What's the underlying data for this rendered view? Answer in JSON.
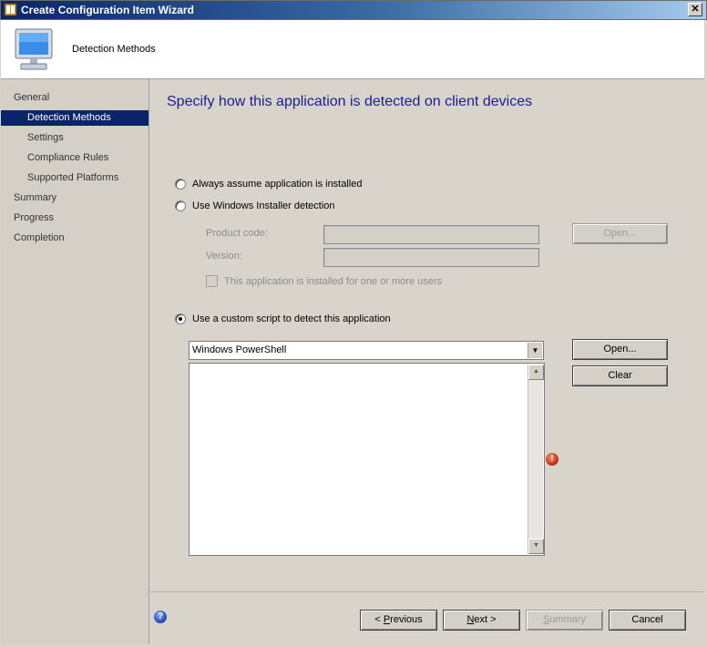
{
  "window": {
    "title": "Create Configuration Item Wizard",
    "close_glyph": "✕"
  },
  "header": {
    "title": "Detection Methods",
    "icon": "monitor-icon"
  },
  "nav": {
    "items": [
      {
        "label": "General"
      },
      {
        "label": "Detection Methods"
      },
      {
        "label": "Settings"
      },
      {
        "label": "Compliance Rules"
      },
      {
        "label": "Supported Platforms"
      },
      {
        "label": "Summary"
      },
      {
        "label": "Progress"
      },
      {
        "label": "Completion"
      }
    ],
    "active": "Detection Methods"
  },
  "main": {
    "heading": "Specify how this application is detected on client devices",
    "options": {
      "always_installed": "Always assume application is installed",
      "windows_installer": "Use Windows Installer detection",
      "custom_script": "Use a custom script to detect this application",
      "selected": "custom_script"
    },
    "installer": {
      "product_code_label": "Product code:",
      "product_code_value": "",
      "version_label": "Version:",
      "version_value": "",
      "per_user_checkbox": "This application is installed for one or more users",
      "per_user_checked": false,
      "open_button": "Open..."
    },
    "script": {
      "language": "Windows PowerShell",
      "content": "",
      "open_button": "Open...",
      "clear_button": "Clear",
      "error_icon": "error-icon"
    }
  },
  "footer": {
    "help_icon": "help-icon",
    "previous_button": {
      "prefix": "< ",
      "mnemonic": "P",
      "rest": "revious"
    },
    "next_button": {
      "mnemonic": "N",
      "rest": "ext >"
    },
    "summary_button": {
      "mnemonic": "S",
      "rest": "ummary"
    },
    "cancel_button": "Cancel"
  },
  "colors": {
    "titlebar_start": "#0a246a",
    "heading": "#1d1d8f",
    "nav_active": "#0a246a",
    "error": "#c0280c"
  }
}
